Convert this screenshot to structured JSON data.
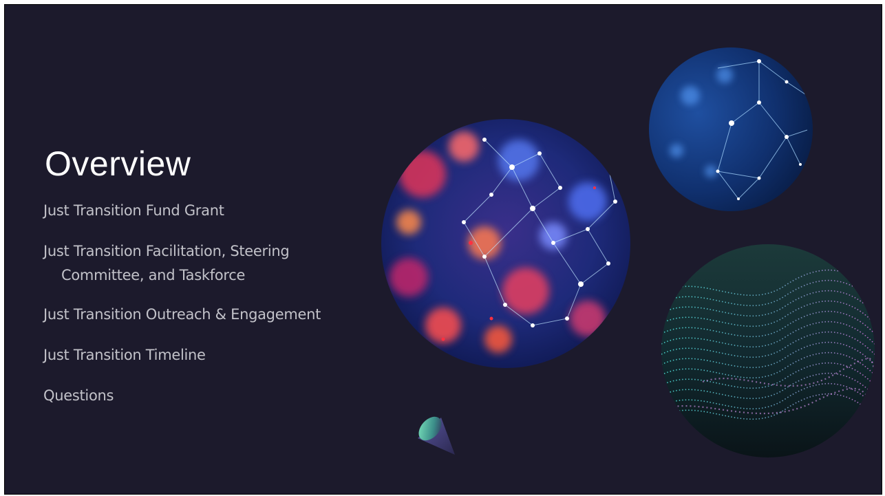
{
  "slide": {
    "title": "Overview",
    "agenda": [
      "Just Transition Fund Grant",
      "Just Transition Facilitation, Steering Committee, and Taskforce",
      "Just Transition Outreach & Engagement",
      "Just Transition Timeline",
      "Questions"
    ]
  },
  "images": {
    "main_circle": "network-bokeh-image",
    "top_circle": "blue-network-image",
    "wave_circle": "digital-wave-image"
  },
  "colors": {
    "background": "#1c1a2c",
    "title": "#ffffff",
    "body_text": "#c2c2c9",
    "cone_gradient": [
      "#6fe0b0",
      "#3d3a6e"
    ]
  }
}
